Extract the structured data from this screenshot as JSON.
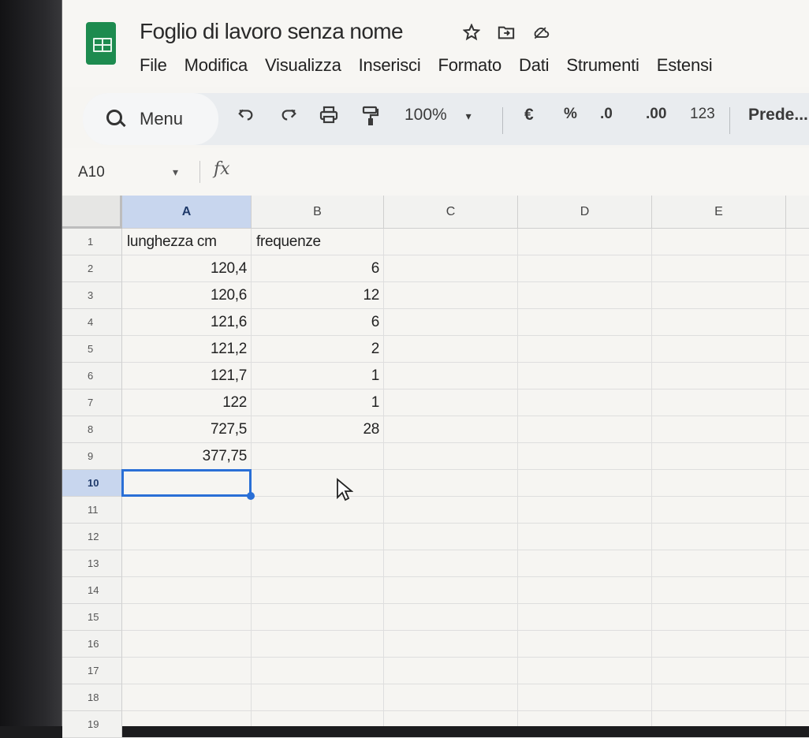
{
  "app": {
    "doc_title": "Foglio di lavoro senza nome",
    "title_icons": [
      "star-icon",
      "move-to-folder-icon",
      "cloud-status-icon"
    ]
  },
  "menubar": [
    "File",
    "Modifica",
    "Visualizza",
    "Inserisci",
    "Formato",
    "Dati",
    "Strumenti",
    "Estensi"
  ],
  "toolbar": {
    "search_label": "Menu",
    "zoom": "100%",
    "currency": "€",
    "percent": "%",
    "decrease_decimals": ".0",
    "increase_decimals": ".00",
    "number_format": "123",
    "font": "Prede..."
  },
  "formula_bar": {
    "name_box": "A10",
    "fx": "fx",
    "value": ""
  },
  "sheet": {
    "columns": [
      "A",
      "B",
      "C",
      "D",
      "E"
    ],
    "selected_column": "A",
    "selected_row": "10",
    "rows": [
      {
        "n": "1",
        "a": "lunghezza cm",
        "b": "frequenze"
      },
      {
        "n": "2",
        "a": "120,4",
        "b": "6"
      },
      {
        "n": "3",
        "a": "120,6",
        "b": "12"
      },
      {
        "n": "4",
        "a": "121,6",
        "b": "6"
      },
      {
        "n": "5",
        "a": "121,2",
        "b": "2"
      },
      {
        "n": "6",
        "a": "121,7",
        "b": "1"
      },
      {
        "n": "7",
        "a": "122",
        "b": "1"
      },
      {
        "n": "8",
        "a": "727,5",
        "b": "28"
      },
      {
        "n": "9",
        "a": "377,75",
        "b": ""
      },
      {
        "n": "10",
        "a": "",
        "b": ""
      },
      {
        "n": "11",
        "a": "",
        "b": ""
      },
      {
        "n": "12",
        "a": "",
        "b": ""
      },
      {
        "n": "13",
        "a": "",
        "b": ""
      },
      {
        "n": "14",
        "a": "",
        "b": ""
      },
      {
        "n": "15",
        "a": "",
        "b": ""
      },
      {
        "n": "16",
        "a": "",
        "b": ""
      },
      {
        "n": "17",
        "a": "",
        "b": ""
      },
      {
        "n": "18",
        "a": "",
        "b": ""
      },
      {
        "n": "19",
        "a": "",
        "b": ""
      }
    ]
  },
  "colors": {
    "accent": "#2a6fd6",
    "selected_header": "#c8d6ee",
    "logo": "#1d8b4f"
  }
}
